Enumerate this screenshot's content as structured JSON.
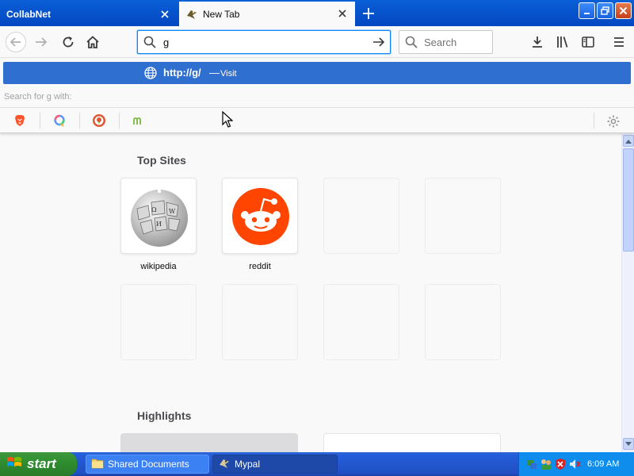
{
  "tabs": [
    {
      "title": "CollabNet",
      "active": false
    },
    {
      "title": "New Tab",
      "active": true
    }
  ],
  "urlbar": {
    "value": "g"
  },
  "searchbar": {
    "placeholder": "Search"
  },
  "dropdown": {
    "visit_url": "http://g/",
    "visit_separator": "—",
    "visit_action": "Visit",
    "search_with_label": "Search for g with:",
    "engines": [
      "brave-icon",
      "qwant-icon",
      "duckduckgo-icon",
      "mojeek-icon"
    ]
  },
  "content": {
    "top_sites_title": "Top Sites",
    "top_sites": [
      {
        "label": "wikipedia",
        "icon": "wikipedia-globe-icon"
      },
      {
        "label": "reddit",
        "icon": "reddit-alien-icon"
      }
    ],
    "highlights_title": "Highlights"
  },
  "taskbar": {
    "start_label": "start",
    "tasks": [
      {
        "label": "Shared Documents",
        "icon": "folder-icon"
      },
      {
        "label": "Mypal",
        "icon": "mypal-icon"
      }
    ],
    "clock": "6:09 AM"
  },
  "colors": {
    "accent": "#0a84ff",
    "visit_row": "#2f6fd0",
    "titlebar": "#0a5fd6",
    "reddit": "#ff4500"
  }
}
